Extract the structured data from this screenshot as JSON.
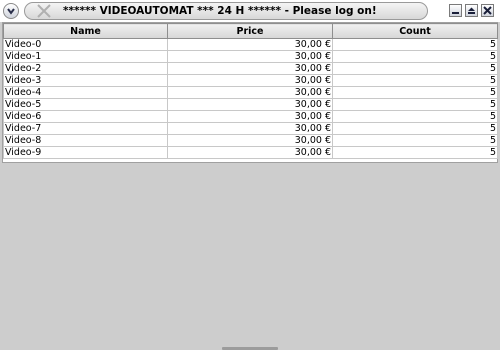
{
  "window": {
    "title": "****** VIDEOAUTOMAT *** 24 H ****** - Please log on!"
  },
  "icons": {
    "menu": "chevron-down-icon",
    "app": "x-logo-icon",
    "minimize": "minimize-icon",
    "maximize": "maximize-icon",
    "close": "close-icon"
  },
  "table": {
    "headers": [
      "Name",
      "Price",
      "Count"
    ],
    "rows": [
      {
        "name": "Video-0",
        "price": "30,00 €",
        "count": "5"
      },
      {
        "name": "Video-1",
        "price": "30,00 €",
        "count": "5"
      },
      {
        "name": "Video-2",
        "price": "30,00 €",
        "count": "5"
      },
      {
        "name": "Video-3",
        "price": "30,00 €",
        "count": "5"
      },
      {
        "name": "Video-4",
        "price": "30,00 €",
        "count": "5"
      },
      {
        "name": "Video-5",
        "price": "30,00 €",
        "count": "5"
      },
      {
        "name": "Video-6",
        "price": "30,00 €",
        "count": "5"
      },
      {
        "name": "Video-7",
        "price": "30,00 €",
        "count": "5"
      },
      {
        "name": "Video-8",
        "price": "30,00 €",
        "count": "5"
      },
      {
        "name": "Video-9",
        "price": "30,00 €",
        "count": "5"
      }
    ]
  },
  "colors": {
    "background": "#cdcdcd",
    "table_bg": "#ffffff"
  }
}
